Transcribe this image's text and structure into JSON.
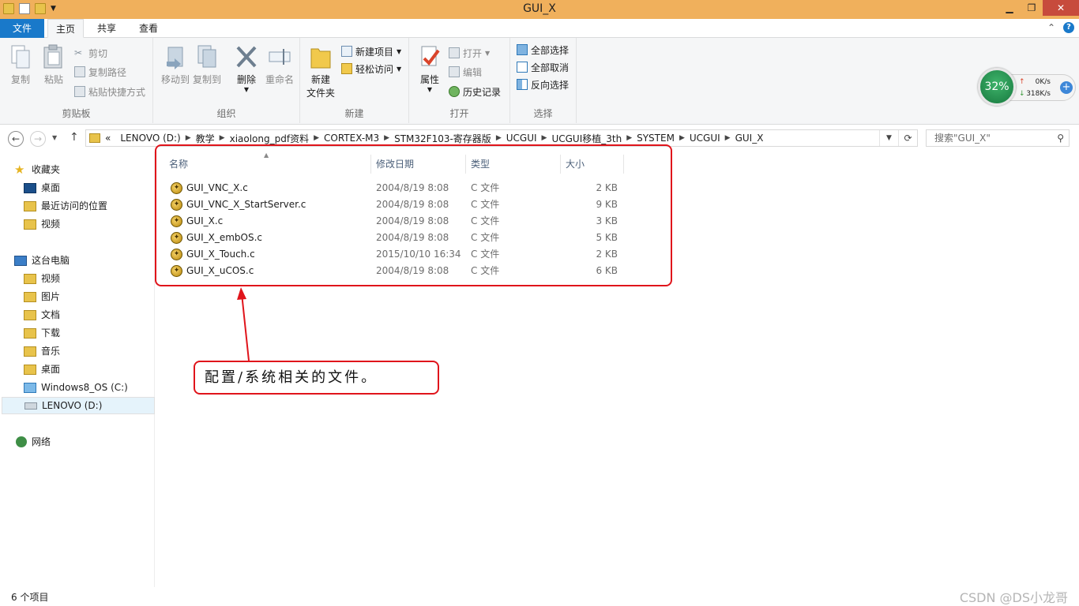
{
  "window": {
    "title": "GUI_X"
  },
  "tabs": {
    "file": "文件",
    "home": "主页",
    "share": "共享",
    "view": "查看"
  },
  "ribbon": {
    "clipboard": {
      "label": "剪贴板",
      "copy": "复制",
      "paste": "粘贴",
      "cut": "剪切",
      "copy_path": "复制路径",
      "paste_shortcut": "粘贴快捷方式"
    },
    "organize": {
      "label": "组织",
      "move_to": "移动到",
      "copy_to": "复制到",
      "delete": "删除",
      "rename": "重命名"
    },
    "new": {
      "label": "新建",
      "new_folder_line1": "新建",
      "new_folder_line2": "文件夹",
      "new_item": "新建项目",
      "easy_access": "轻松访问"
    },
    "open": {
      "label": "打开",
      "properties": "属性",
      "open": "打开",
      "edit": "编辑",
      "history": "历史记录"
    },
    "select": {
      "label": "选择",
      "select_all": "全部选择",
      "select_none": "全部取消",
      "invert": "反向选择"
    }
  },
  "widget": {
    "percent": "32%",
    "up": "0K/s",
    "down": "318K/s"
  },
  "address": {
    "prefix": "«",
    "segments": [
      "LENOVO (D:)",
      "教学",
      "xiaolong_pdf资料",
      "CORTEX-M3",
      "STM32F103-寄存器版",
      "UCGUI",
      "UCGUI移植_3th",
      "SYSTEM",
      "UCGUI",
      "GUI_X"
    ],
    "search_placeholder": "搜索\"GUI_X\""
  },
  "navpane": {
    "favorites": "收藏夹",
    "fav_items": [
      "桌面",
      "最近访问的位置",
      "视频"
    ],
    "thispc": "这台电脑",
    "pc_items": [
      "视频",
      "图片",
      "文档",
      "下载",
      "音乐",
      "桌面",
      "Windows8_OS (C:)",
      "LENOVO (D:)"
    ],
    "network": "网络"
  },
  "columns": {
    "name": "名称",
    "date": "修改日期",
    "type": "类型",
    "size": "大小"
  },
  "files": [
    {
      "name": "GUI_VNC_X.c",
      "date": "2004/8/19 8:08",
      "type": "C 文件",
      "size": "2 KB"
    },
    {
      "name": "GUI_VNC_X_StartServer.c",
      "date": "2004/8/19 8:08",
      "type": "C 文件",
      "size": "9 KB"
    },
    {
      "name": "GUI_X.c",
      "date": "2004/8/19 8:08",
      "type": "C 文件",
      "size": "3 KB"
    },
    {
      "name": "GUI_X_embOS.c",
      "date": "2004/8/19 8:08",
      "type": "C 文件",
      "size": "5 KB"
    },
    {
      "name": "GUI_X_Touch.c",
      "date": "2015/10/10 16:34",
      "type": "C 文件",
      "size": "2 KB"
    },
    {
      "name": "GUI_X_uCOS.c",
      "date": "2004/8/19 8:08",
      "type": "C 文件",
      "size": "6 KB"
    }
  ],
  "annotation": {
    "text": "配置/系统相关的文件。"
  },
  "status": {
    "count": "6 个项目",
    "watermark": "CSDN @DS小龙哥"
  }
}
